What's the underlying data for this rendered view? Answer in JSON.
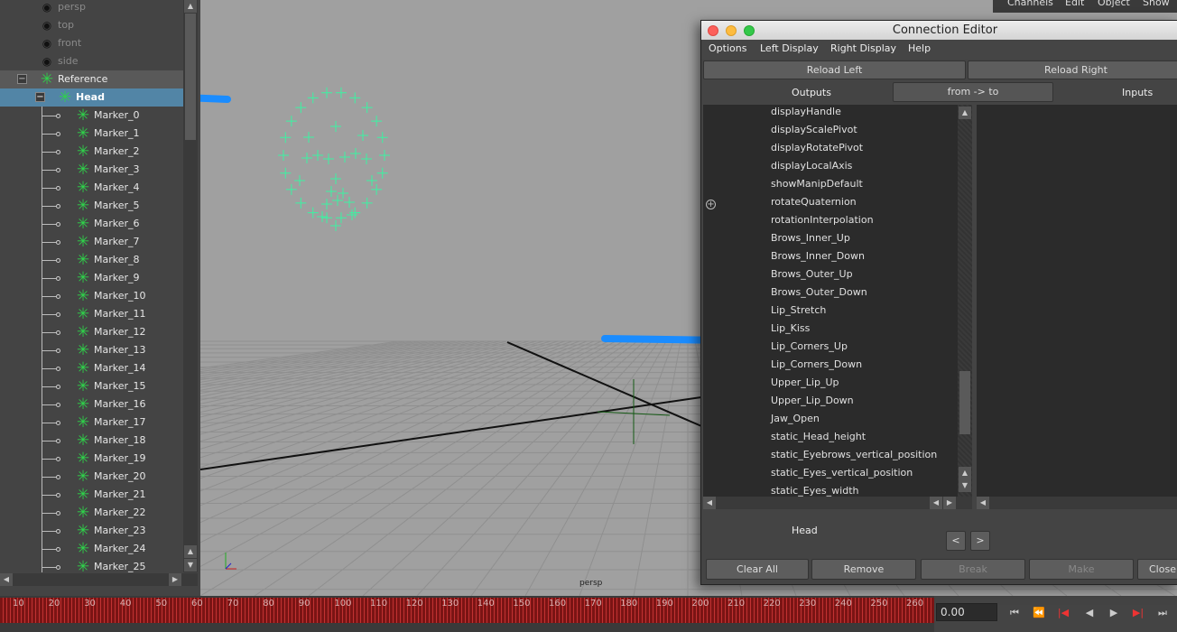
{
  "outliner": {
    "cameras": [
      "persp",
      "top",
      "front",
      "side"
    ],
    "reference": "Reference",
    "head": "Head",
    "markers": [
      "Marker_0",
      "Marker_1",
      "Marker_2",
      "Marker_3",
      "Marker_4",
      "Marker_5",
      "Marker_6",
      "Marker_7",
      "Marker_8",
      "Marker_9",
      "Marker_10",
      "Marker_11",
      "Marker_12",
      "Marker_13",
      "Marker_14",
      "Marker_15",
      "Marker_16",
      "Marker_17",
      "Marker_18",
      "Marker_19",
      "Marker_20",
      "Marker_21",
      "Marker_22",
      "Marker_23",
      "Marker_24",
      "Marker_25"
    ]
  },
  "channel_box": {
    "menu": [
      "Channels",
      "Edit",
      "Object",
      "Show"
    ]
  },
  "viewport": {
    "camera_label": "persp"
  },
  "connection_editor": {
    "title": "Connection Editor",
    "menu": [
      "Options",
      "Left Display",
      "Right Display",
      "Help"
    ],
    "reload_left": "Reload Left",
    "reload_right": "Reload Right",
    "outputs_label": "Outputs",
    "direction_button": "from -> to",
    "inputs_label": "Inputs",
    "attributes": [
      "displayHandle",
      "displayScalePivot",
      "displayRotatePivot",
      "displayLocalAxis",
      "showManipDefault",
      "rotateQuaternion",
      "rotationInterpolation",
      "Brows_Inner_Up",
      "Brows_Inner_Down",
      "Brows_Outer_Up",
      "Brows_Outer_Down",
      "Lip_Stretch",
      "Lip_Kiss",
      "Lip_Corners_Up",
      "Lip_Corners_Down",
      "Upper_Lip_Up",
      "Upper_Lip_Down",
      "Jaw_Open",
      "static_Head_height",
      "static_Eyebrows_vertical_position",
      "static_Eyes_vertical_position",
      "static_Eyes_width"
    ],
    "left_node": "Head",
    "prev_label": "<",
    "next_label": ">",
    "buttons": {
      "clear_all": "Clear All",
      "remove": "Remove",
      "break": "Break",
      "make": "Make",
      "close": "Close"
    }
  },
  "timeline": {
    "ticks": [
      "10",
      "20",
      "30",
      "40",
      "50",
      "60",
      "70",
      "80",
      "90",
      "100",
      "110",
      "120",
      "130",
      "140",
      "150",
      "160",
      "170",
      "180",
      "190",
      "200",
      "210",
      "220",
      "230",
      "240",
      "250",
      "260"
    ],
    "current_time": "0.00"
  },
  "colors": {
    "annotation_arrow": "#1a8cff",
    "marker_green": "#2fd24a",
    "selection": "#5285a6"
  }
}
